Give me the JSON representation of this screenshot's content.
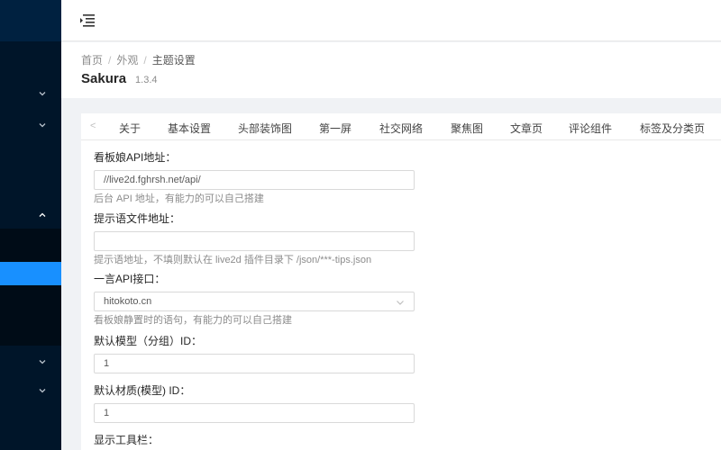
{
  "header": {
    "menu_toggle_icon": "menu-fold-icon"
  },
  "breadcrumb": {
    "items": [
      "首页",
      "外观",
      "主题设置"
    ],
    "separator": "/"
  },
  "page": {
    "title": "Sakura",
    "version": "1.3.4"
  },
  "tabs": {
    "items": [
      "关于",
      "基本设置",
      "头部装饰图",
      "第一屏",
      "社交网络",
      "聚焦图",
      "文章页",
      "评论组件",
      "标签及分类页"
    ]
  },
  "form": {
    "fields": [
      {
        "label": "看板娘API地址：",
        "value": "//live2d.fghrsh.net/api/",
        "placeholder": "",
        "help": "后台 API 地址，有能力的可以自己搭建"
      },
      {
        "label": "提示语文件地址：",
        "value": "",
        "placeholder": "",
        "help": "提示语地址，不填则默认在 live2d 插件目录下 /json/***-tips.json"
      },
      {
        "label": "一言API接口：",
        "value": "hitokoto.cn",
        "help": "看板娘静置时的语句，有能力的可以自己搭建"
      },
      {
        "label": "默认模型（分组）ID：",
        "value": "1"
      },
      {
        "label": "默认材质(模型) ID：",
        "value": "1"
      },
      {
        "label": "显示工具栏："
      }
    ]
  },
  "colors": {
    "sidebar_bg": "#001529",
    "sidebar_active": "#1890ff",
    "submenu_bg": "#000c17"
  }
}
